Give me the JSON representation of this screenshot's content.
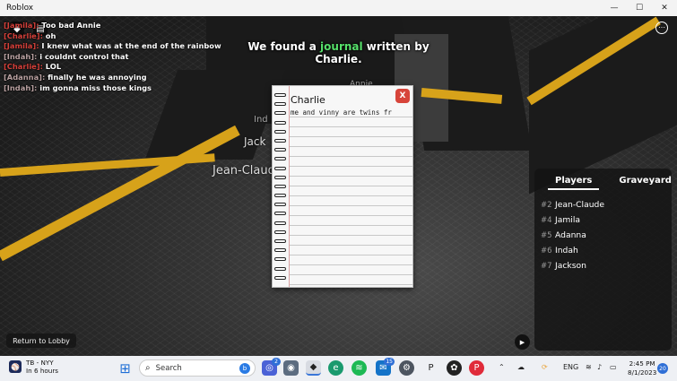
{
  "window": {
    "title": "Roblox",
    "minimize_glyph": "—",
    "maximize_glyph": "☐",
    "close_glyph": "✕"
  },
  "chat": [
    {
      "name": "[Jamila]:",
      "message": "Too bad Annie",
      "name_style": "red"
    },
    {
      "name": "[Charlie]:",
      "message": "oh",
      "name_style": "red"
    },
    {
      "name": "[Jamila]:",
      "message": "I knew what was at the end of the rainbow",
      "name_style": "red"
    },
    {
      "name": "[Indah]:",
      "message": "i couldnt control that",
      "name_style": "indah"
    },
    {
      "name": "[Charlie]:",
      "message": "LOL",
      "name_style": "red"
    },
    {
      "name": "[Adanna]:",
      "message": "finally he was annoying",
      "name_style": "adanna"
    },
    {
      "name": "[Indah]:",
      "message": "im gonna miss those kings",
      "name_style": "indah"
    }
  ],
  "announcement": {
    "prefix": "We found a ",
    "highlight": "journal",
    "suffix": " written by",
    "line2": "Charlie."
  },
  "floating_names": {
    "annie": "Annie",
    "ind": "Ind",
    "jack": "Jack",
    "jean": "Jean-Claude"
  },
  "journal": {
    "title": "Charlie",
    "text": "me and vinny are twins fr",
    "close_label": "X"
  },
  "players_panel": {
    "tabs": [
      "Players",
      "Graveyard"
    ],
    "active_tab": "Players",
    "players": [
      {
        "num": "#2",
        "name": "Jean-Claude"
      },
      {
        "num": "#4",
        "name": "Jamila"
      },
      {
        "num": "#5",
        "name": "Adanna"
      },
      {
        "num": "#6",
        "name": "Indah"
      },
      {
        "num": "#7",
        "name": "Jackson"
      }
    ]
  },
  "lobby_button": "Return to Lobby",
  "taskbar": {
    "weather_line1": "TB - NYY",
    "weather_line2": "In 6 hours",
    "search_placeholder": "Search",
    "widgets_badge": "2",
    "mail_badge": "15",
    "language": "ENG",
    "time": "2:45 PM",
    "date": "8/1/2023",
    "notification_count": "20"
  },
  "colors": {
    "chat_name_red": "#d4403a",
    "journal_highlight": "#56e06a",
    "close_button": "#d7443a",
    "floor_stripe": "#d7a21a"
  }
}
